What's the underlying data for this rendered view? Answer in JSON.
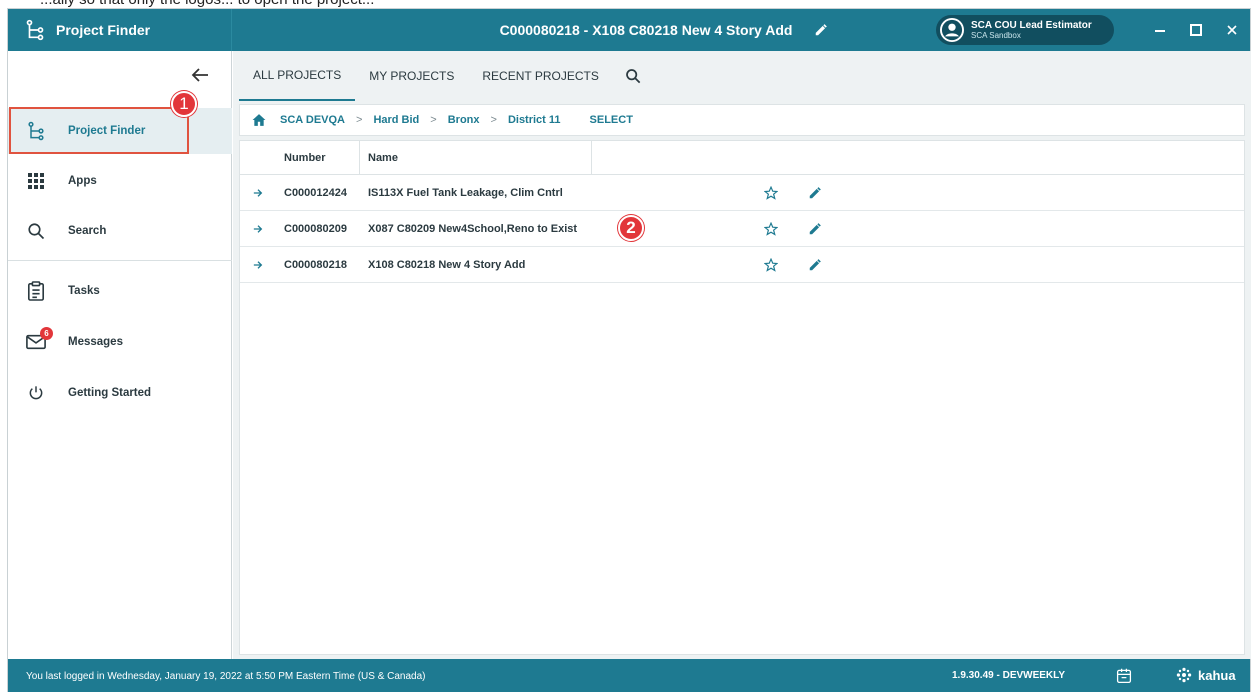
{
  "caption": "...ally so that only the logos... to open the project...",
  "titlebar": {
    "app_name": "Project Finder",
    "project_title": "C000080218 - X108 C80218 New 4 Story Add",
    "user_name": "SCA COU Lead Estimator",
    "user_env": "SCA Sandbox"
  },
  "sidebar": {
    "items": [
      {
        "label": "Project Finder",
        "icon": "project-tree-icon"
      },
      {
        "label": "Apps",
        "icon": "apps-grid-icon"
      },
      {
        "label": "Search",
        "icon": "search-icon"
      },
      {
        "label": "Tasks",
        "icon": "clipboard-icon"
      },
      {
        "label": "Messages",
        "icon": "envelope-icon"
      },
      {
        "label": "Getting Started",
        "icon": "power-icon"
      }
    ],
    "messages_count": "6"
  },
  "callouts": {
    "one": "1",
    "two": "2"
  },
  "tabs": [
    {
      "label": "ALL PROJECTS"
    },
    {
      "label": "MY PROJECTS"
    },
    {
      "label": "RECENT PROJECTS"
    }
  ],
  "breadcrumb": {
    "items": [
      "SCA DEVQA",
      "Hard Bid",
      "Bronx",
      "District 11"
    ],
    "select": "SELECT"
  },
  "table": {
    "headers": {
      "number": "Number",
      "name": "Name"
    },
    "rows": [
      {
        "number": "C000012424",
        "name": "IS113X Fuel Tank Leakage, Clim Cntrl"
      },
      {
        "number": "C000080209",
        "name": "X087 C80209 New4School,Reno to Exist"
      },
      {
        "number": "C000080218",
        "name": "X108 C80218 New 4 Story Add"
      }
    ]
  },
  "footer": {
    "last_login": "You last logged in Wednesday, January 19, 2022 at 5:50 PM Eastern Time (US & Canada)",
    "version": "1.9.30.49 - DEVWEEKLY",
    "brand": "kahua"
  },
  "colors": {
    "primary": "#1e7a91",
    "callout": "#e2363a",
    "highlight": "#e0533f"
  }
}
